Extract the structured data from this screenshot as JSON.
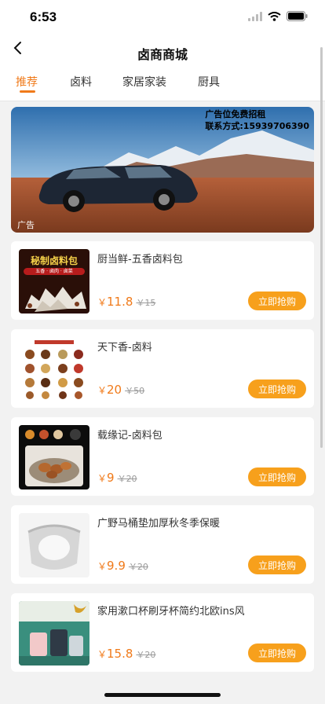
{
  "status": {
    "time": "6:53"
  },
  "header": {
    "title": "卤商商城"
  },
  "tabs": [
    {
      "label": "推荐",
      "active": true
    },
    {
      "label": "卤料",
      "active": false
    },
    {
      "label": "家居家装",
      "active": false
    },
    {
      "label": "厨具",
      "active": false
    }
  ],
  "banner": {
    "ad_line1": "广告位免费招租",
    "ad_line2": "联系方式:15939706390",
    "tag": "广告"
  },
  "buy_label": "立即抢购",
  "currency": "￥",
  "products": [
    {
      "name": "厨当鲜-五香卤料包",
      "price": "11.8",
      "orig_price": "15",
      "thumb_text": "秘制卤料包",
      "thumb_sub": "五香 · 卤肉 · 卤菜"
    },
    {
      "name": "天下香-卤料",
      "price": "20",
      "orig_price": "50",
      "thumb_text": "",
      "thumb_sub": ""
    },
    {
      "name": "载缘记-卤料包",
      "price": "9",
      "orig_price": "20",
      "thumb_text": "",
      "thumb_sub": ""
    },
    {
      "name": "广野马桶垫加厚秋冬季保暖",
      "price": "9.9",
      "orig_price": "20",
      "thumb_text": "",
      "thumb_sub": ""
    },
    {
      "name": "家用漱口杯刷牙杯简约北欧ins风",
      "price": "15.8",
      "orig_price": "20",
      "thumb_text": "",
      "thumb_sub": ""
    }
  ],
  "colors": {
    "accent": "#f07a1a",
    "button": "#f7a01c"
  }
}
